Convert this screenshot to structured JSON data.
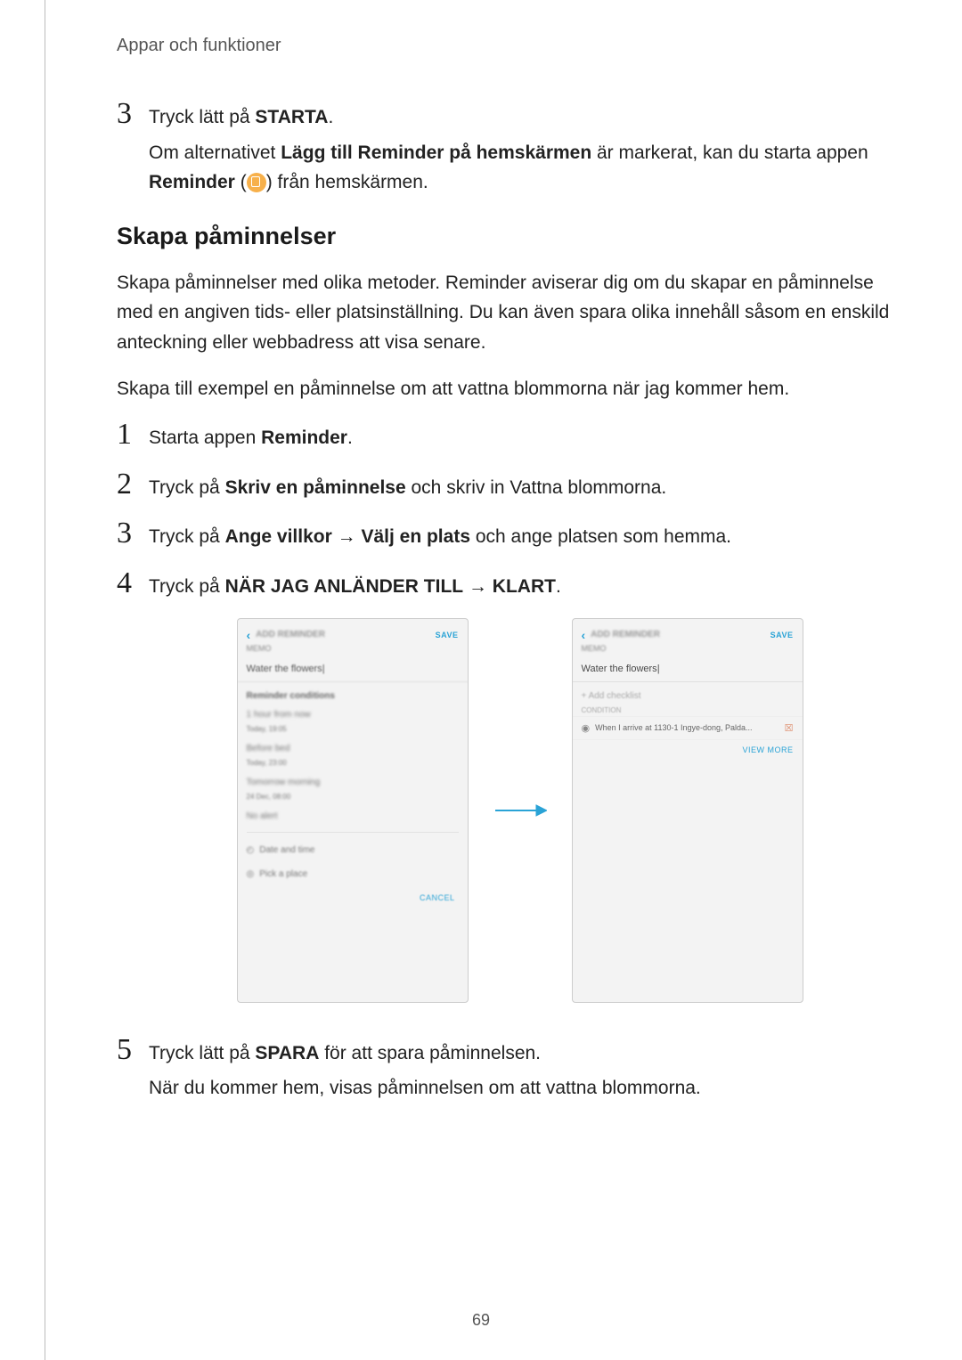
{
  "header": "Appar och funktioner",
  "pre_step": {
    "num": "3",
    "line": "Tryck lätt på ",
    "bold": "STARTA",
    "line_end": "."
  },
  "pre_running_1_a": "Om alternativet ",
  "pre_running_1_b": "Lägg till Reminder på hemskärmen",
  "pre_running_1_c": " är markerat, kan du starta appen ",
  "pre_running_2_a": "Reminder",
  "pre_running_2_b": " (",
  "pre_running_2_c": ") från hemskärmen.",
  "h2": "Skapa påminnelser",
  "para1": "Skapa påminnelser med olika metoder. Reminder aviserar dig om du skapar en påminnelse med en angiven tids- eller platsinställning. Du kan även spara olika innehåll såsom en enskild anteckning eller webbadress att visa senare.",
  "para2": "Skapa till exempel en påminnelse om att vattna blommorna när jag kommer hem.",
  "steps": [
    {
      "n": "1",
      "pre": "Starta appen ",
      "b": "Reminder",
      "post": "."
    },
    {
      "n": "2",
      "pre": "Tryck på ",
      "b": "Skriv en påminnelse",
      "post": " och skriv in Vattna blommorna."
    },
    {
      "n": "3",
      "pre": "Tryck på ",
      "b": "Ange villkor",
      "arrow": " → ",
      "b2": "Välj en plats",
      "post": " och ange platsen som hemma."
    },
    {
      "n": "4",
      "pre": "Tryck på ",
      "b": "NÄR JAG ANLÄNDER TILL",
      "arrow": " → ",
      "b2": "KLART",
      "post": "."
    }
  ],
  "mock": {
    "title": "ADD REMINDER",
    "save": "SAVE",
    "memo": "MEMO",
    "input": "Water the flowers",
    "cursor": "|",
    "cond_header": "Reminder conditions",
    "r1": "1 hour from now",
    "r1s": "Today, 19:05",
    "r2": "Before bed",
    "r2s": "Today, 23:00",
    "r3": "Tomorrow morning",
    "r3s": "24 Dec, 08:00",
    "r4": "No alert",
    "opt1": "Date and time",
    "opt2": "Pick a place",
    "cancel": "CANCEL",
    "addcheck": "+  Add checklist",
    "cond_lbl": "CONDITION",
    "loc": "When I arrive at 1130-1 Ingye-dong, Palda...",
    "viewmore": "VIEW MORE"
  },
  "final_step": {
    "n": "5",
    "pre": "Tryck lätt på ",
    "b": "SPARA",
    "post": " för att spara påminnelsen."
  },
  "final_running": "När du kommer hem, visas påminnelsen om att vattna blommorna.",
  "page_number": "69"
}
